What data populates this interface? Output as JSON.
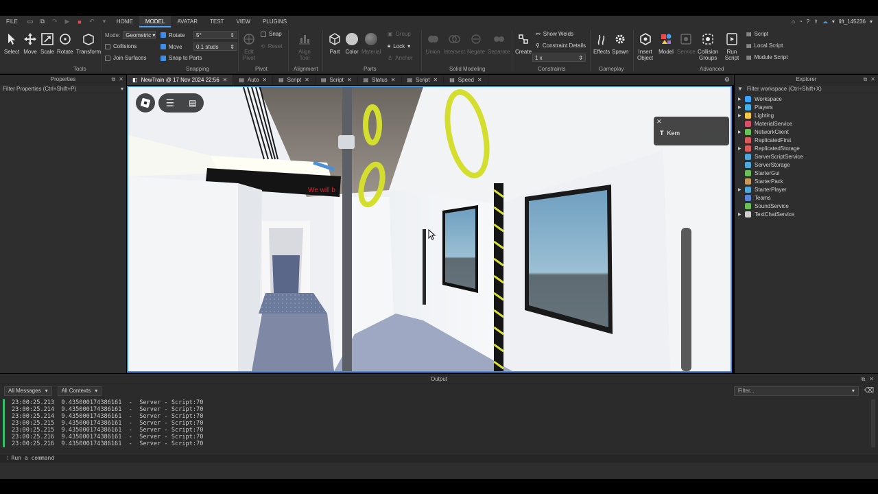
{
  "menu": {
    "items": [
      "FILE",
      "HOME",
      "MODEL",
      "AVATAR",
      "TEST",
      "VIEW",
      "PLUGINS"
    ],
    "active": "MODEL",
    "username": "lift_145236"
  },
  "ribbon": {
    "tools": {
      "select": "Select",
      "move": "Move",
      "scale": "Scale",
      "rotate": "Rotate",
      "transform": "Transform",
      "group": "Tools"
    },
    "mode_label": "Mode:",
    "mode_value": "Geometric",
    "collisions": "Collisions",
    "join_surfaces": "Join Surfaces",
    "rotate_label": "Rotate",
    "rotate_value": "5°",
    "move_label": "Move",
    "move_value": "0.1 studs",
    "snap_to_parts": "Snap to Parts",
    "snapping_group": "Snapping",
    "snap": "Snap",
    "edit_pivot": "Edit\nPivot",
    "reset": "Reset",
    "pivot_group": "Pivot",
    "align_tool": "Align\nTool",
    "alignment_group": "Alignment",
    "part": "Part",
    "color": "Color",
    "material": "Material",
    "group_btn": "Group",
    "lock": "Lock",
    "anchor": "Anchor",
    "parts_group": "Parts",
    "union": "Union",
    "intersect": "Intersect",
    "negate": "Negate",
    "separate": "Separate",
    "solid_group": "Solid Modeling",
    "create": "Create",
    "show_welds": "Show Welds",
    "constraint_details": "Constraint Details",
    "scale_value": "1 x",
    "constraints_group": "Constraints",
    "effects": "Effects",
    "spawn": "Spawn",
    "gameplay_group": "Gameplay",
    "insert_object": "Insert\nObject",
    "model": "Model",
    "service": "Service",
    "collision_groups": "Collision\nGroups",
    "run_script": "Run\nScript",
    "script": "Script",
    "local_script": "Local Script",
    "module_script": "Module Script",
    "advanced_group": "Advanced"
  },
  "properties": {
    "title": "Properties",
    "filter": "Filter Properties (Ctrl+Shift+P)"
  },
  "tabs": [
    {
      "label": "NewTrain @ 17 Nov 2024 22:56",
      "active": true
    },
    {
      "label": "Auto"
    },
    {
      "label": "Script"
    },
    {
      "label": "Script"
    },
    {
      "label": "Status"
    },
    {
      "label": "Script"
    },
    {
      "label": "Speed"
    }
  ],
  "viewport": {
    "sign_text": "We will b",
    "chat_name": "Kem"
  },
  "explorer": {
    "title": "Explorer",
    "filter": "Filter workspace (Ctrl+Shift+X)",
    "items": [
      {
        "label": "Workspace",
        "expandable": true,
        "color": "#3aa3ff"
      },
      {
        "label": "Players",
        "expandable": true,
        "color": "#46b0e6"
      },
      {
        "label": "Lighting",
        "expandable": true,
        "color": "#f2c84b"
      },
      {
        "label": "MaterialService",
        "expandable": false,
        "color": "#d94f6a"
      },
      {
        "label": "NetworkClient",
        "expandable": true,
        "color": "#6bbf59"
      },
      {
        "label": "ReplicatedFirst",
        "expandable": false,
        "color": "#d95b5b"
      },
      {
        "label": "ReplicatedStorage",
        "expandable": true,
        "color": "#d95b5b"
      },
      {
        "label": "ServerScriptService",
        "expandable": false,
        "color": "#4fa8d9"
      },
      {
        "label": "ServerStorage",
        "expandable": false,
        "color": "#4fa8d9"
      },
      {
        "label": "StarterGui",
        "expandable": false,
        "color": "#6bbf59"
      },
      {
        "label": "StarterPack",
        "expandable": false,
        "color": "#c79a5a"
      },
      {
        "label": "StarterPlayer",
        "expandable": true,
        "color": "#4fa8d9"
      },
      {
        "label": "Teams",
        "expandable": false,
        "color": "#5a86d9"
      },
      {
        "label": "SoundService",
        "expandable": false,
        "color": "#6bbf59"
      },
      {
        "label": "TextChatService",
        "expandable": true,
        "color": "#cfcfcf"
      }
    ]
  },
  "output": {
    "title": "Output",
    "messages_filter": "All Messages",
    "contexts_filter": "All Contexts",
    "search_placeholder": "Filter...",
    "lines": [
      "23:00:25.213  9.435000174386161  -  Server - Script:70",
      "23:00:25.214  9.435000174386161  -  Server - Script:70",
      "23:00:25.214  9.435000174386161  -  Server - Script:70",
      "23:00:25.215  9.435000174386161  -  Server - Script:70",
      "23:00:25.215  9.435000174386161  -  Server - Script:70",
      "23:00:25.216  9.435000174386161  -  Server - Script:70",
      "23:00:25.216  9.435000174386161  -  Server - Script:70"
    ],
    "command_placeholder": "Run a command"
  },
  "colors": {
    "accent": "#3a8fe0",
    "log_marker": "#33c26b",
    "strap_yellow": "#d8e23a"
  }
}
